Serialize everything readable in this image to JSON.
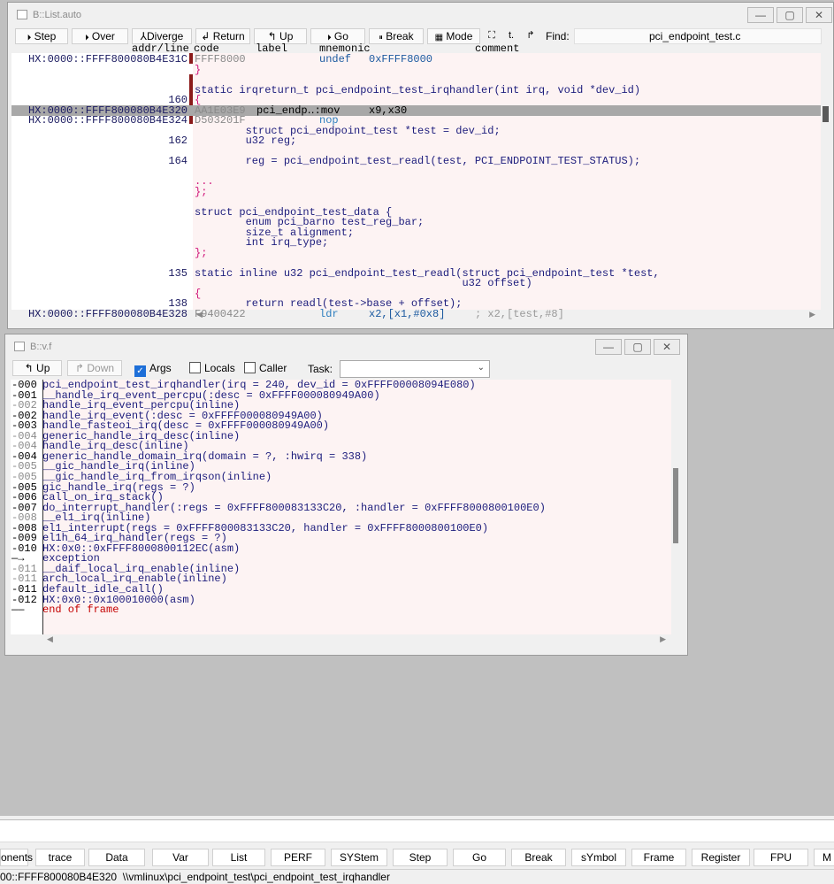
{
  "list_window": {
    "title": "B::List.auto",
    "buttons": {
      "step": "Step",
      "over": "Over",
      "diverge": "Diverge",
      "return": "Return",
      "up": "Up",
      "go": "Go",
      "break": "Break",
      "mode": "Mode",
      "find_label": "Find:",
      "find_value": "pci_endpoint_test.c"
    },
    "icons": {
      "step": "⏵",
      "over": "⏵",
      "diverge": "⅄",
      "return": "↲",
      "up": "↰",
      "go": "⏵",
      "break": "⏸",
      "mode": "▦",
      "e1": "⛶",
      "e2": "t.",
      "e3": "↱"
    },
    "columns": {
      "addr": "addr/line",
      "code": "code",
      "label": "label",
      "mnemonic": "mnemonic",
      "comment": "comment"
    },
    "lines": [
      {
        "addr": "HX:0000::FFFF800080B4E31C",
        "code": "FFFF8000",
        "label": "",
        "mnem": "undef",
        "ops": "0xFFFF8000",
        "comment": ""
      },
      {
        "text": "}"
      },
      {
        "text": ""
      },
      {
        "text": "static irqreturn_t pci_endpoint_test_irqhandler(int irq, void *dev_id)"
      },
      {
        "num": "160",
        "text": "{"
      },
      {
        "addr": "HX:0000::FFFF800080B4E320",
        "code": "AA1E03E9",
        "label": "pci_endp‥:mov",
        "mnem": "",
        "ops": "x9,x30",
        "comment": ""
      },
      {
        "addr": "HX:0000::FFFF800080B4E324",
        "code": "D503201F",
        "label": "",
        "mnem": "nop",
        "ops": "",
        "comment": ""
      },
      {
        "text": "        struct pci_endpoint_test *test = dev_id;"
      },
      {
        "num": "162",
        "text": "        u32 reg;"
      },
      {
        "text": ""
      },
      {
        "num": "164",
        "text": "        reg = pci_endpoint_test_readl(test, PCI_ENDPOINT_TEST_STATUS);"
      },
      {
        "text": ""
      },
      {
        "text": "..."
      },
      {
        "text": "};"
      },
      {
        "text": ""
      },
      {
        "text": "struct pci_endpoint_test_data {"
      },
      {
        "text": "        enum pci_barno test_reg_bar;"
      },
      {
        "text": "        size_t alignment;"
      },
      {
        "text": "        int irq_type;"
      },
      {
        "text": "};"
      },
      {
        "text": ""
      },
      {
        "num": "135",
        "text": "static inline u32 pci_endpoint_test_readl(struct pci_endpoint_test *test,"
      },
      {
        "text": "                                          u32 offset)"
      },
      {
        "text": "{"
      },
      {
        "num": "138",
        "text": "        return readl(test->base + offset);"
      },
      {
        "addr": "HX:0000::FFFF800080B4E328",
        "code": "F9400422",
        "label": "",
        "mnem": "ldr",
        "ops": "x2,[x1,#0x8]",
        "comment": "; x2,[test,#8]"
      }
    ]
  },
  "frame_window": {
    "title": "B::v.f",
    "buttons": {
      "up": "Up",
      "down": "Down",
      "args": "Args",
      "locals": "Locals",
      "caller": "Caller",
      "task": "Task:"
    },
    "icons": {
      "up": "↰",
      "down": "↱"
    },
    "frames": [
      {
        "lvl": "-000",
        "text": "pci_endpoint_test_irqhandler(irq = 240, dev_id = 0xFFFF00008094E080)",
        "gray": false
      },
      {
        "lvl": "-001",
        "text": "__handle_irq_event_percpu(:desc = 0xFFFF000080949A00)",
        "gray": false
      },
      {
        "lvl": "-002",
        "text": "handle_irq_event_percpu(inline)",
        "gray": true
      },
      {
        "lvl": "-002",
        "text": "handle_irq_event(:desc = 0xFFFF000080949A00)",
        "gray": false
      },
      {
        "lvl": "-003",
        "text": "handle_fasteoi_irq(desc = 0xFFFF000080949A00)",
        "gray": false
      },
      {
        "lvl": "-004",
        "text": "generic_handle_irq_desc(inline)",
        "gray": true
      },
      {
        "lvl": "-004",
        "text": "handle_irq_desc(inline)",
        "gray": true
      },
      {
        "lvl": "-004",
        "text": "generic_handle_domain_irq(domain = ?, :hwirq = 338)",
        "gray": false
      },
      {
        "lvl": "-005",
        "text": "__gic_handle_irq(inline)",
        "gray": true
      },
      {
        "lvl": "-005",
        "text": "__gic_handle_irq_from_irqson(inline)",
        "gray": true
      },
      {
        "lvl": "-005",
        "text": "gic_handle_irq(regs = ?)",
        "gray": false
      },
      {
        "lvl": "-006",
        "text": "call_on_irq_stack()",
        "gray": false
      },
      {
        "lvl": "-007",
        "text": "do_interrupt_handler(:regs = 0xFFFF800083133C20, :handler = 0xFFFF8000800100E0)",
        "gray": false
      },
      {
        "lvl": "-008",
        "text": "__el1_irq(inline)",
        "gray": true
      },
      {
        "lvl": "-008",
        "text": "el1_interrupt(regs = 0xFFFF800083133C20, handler = 0xFFFF8000800100E0)",
        "gray": false
      },
      {
        "lvl": "-009",
        "text": "el1h_64_irq_handler(regs = ?)",
        "gray": false
      },
      {
        "lvl": "-010",
        "text": "HX:0x0::0xFFFF8000800112EC(asm)",
        "gray": false
      },
      {
        "lvl": "—→",
        "text": "exception",
        "gray": false
      },
      {
        "lvl": "-011",
        "text": "__daif_local_irq_enable(inline)",
        "gray": true
      },
      {
        "lvl": "-011",
        "text": "arch_local_irq_enable(inline)",
        "gray": true
      },
      {
        "lvl": "-011",
        "text": "default_idle_call()",
        "gray": false
      },
      {
        "lvl": "-012",
        "text": "HX:0x0::0x100010000(asm)",
        "gray": false
      },
      {
        "lvl": "——",
        "text": "end of frame",
        "gray": false,
        "red": true
      }
    ]
  },
  "function_keys": [
    "onents",
    "trace",
    "Data",
    "Var",
    "List",
    "PERF",
    "SYStem",
    "Step",
    "Go",
    "Break",
    "sYmbol",
    "Frame",
    "Register",
    "FPU",
    "M"
  ],
  "status_text": "00::FFFF800080B4E320  \\\\vmlinux\\pci_endpoint_test\\pci_endpoint_test_irqhandler",
  "colors": {
    "code_bg": "#fdf3f3",
    "source_blue": "#1c1c7c",
    "brace_pink": "#d0157a",
    "highlight_gray": "#a8a8a8",
    "breakpoint_red": "#8b1a1a"
  }
}
